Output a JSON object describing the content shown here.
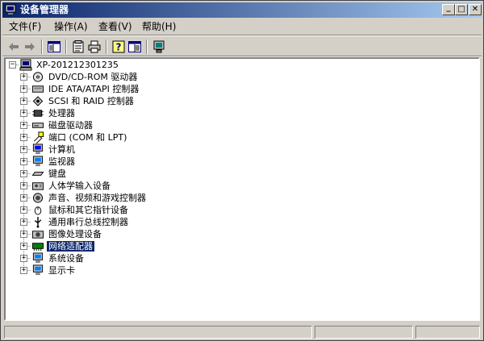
{
  "window": {
    "title": "设备管理器",
    "controls": {
      "minimize": "_",
      "maximize": "□",
      "close": "✕"
    }
  },
  "menu": [
    "文件(F)",
    "操作(A)",
    "查看(V)",
    "帮助(H)"
  ],
  "toolbar": [
    "back-arrow-icon",
    "forward-arrow-icon",
    "show-hide-tree-icon",
    "properties-icon",
    "print-icon",
    "help-icon",
    "details-icon",
    "scan-hardware-icon"
  ],
  "tree": {
    "root": "XP-201212301235",
    "items": [
      {
        "label": "DVD/CD-ROM 驱动器",
        "icon": "cdrom-icon"
      },
      {
        "label": "IDE ATA/ATAPI 控制器",
        "icon": "ide-controller-icon"
      },
      {
        "label": "SCSI 和 RAID 控制器",
        "icon": "scsi-icon"
      },
      {
        "label": "处理器",
        "icon": "processor-icon"
      },
      {
        "label": "磁盘驱动器",
        "icon": "disk-drive-icon"
      },
      {
        "label": "端口 (COM 和 LPT)",
        "icon": "port-icon"
      },
      {
        "label": "计算机",
        "icon": "computer-icon"
      },
      {
        "label": "监视器",
        "icon": "monitor-icon"
      },
      {
        "label": "键盘",
        "icon": "keyboard-icon"
      },
      {
        "label": "人体学输入设备",
        "icon": "hid-icon"
      },
      {
        "label": "声音、视频和游戏控制器",
        "icon": "sound-icon"
      },
      {
        "label": "鼠标和其它指针设备",
        "icon": "mouse-icon"
      },
      {
        "label": "通用串行总线控制器",
        "icon": "usb-icon"
      },
      {
        "label": "图像处理设备",
        "icon": "camera-icon"
      },
      {
        "label": "网络适配器",
        "icon": "network-adapter-icon",
        "selected": true
      },
      {
        "label": "系统设备",
        "icon": "system-device-icon"
      },
      {
        "label": "显示卡",
        "icon": "display-adapter-icon"
      }
    ]
  }
}
